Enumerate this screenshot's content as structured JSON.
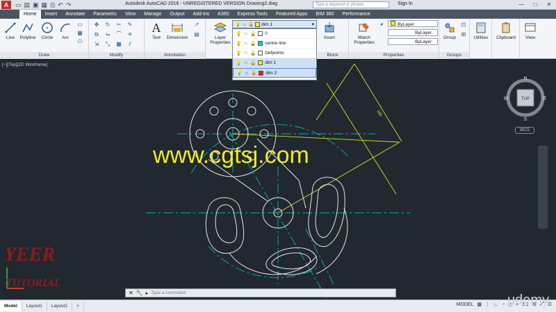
{
  "app": {
    "title": "Autodesk AutoCAD 2016 - UNREGISTERED VERSION   Drawing2.dwg",
    "search_placeholder": "Type a keyword or phrase",
    "signin": "Sign In"
  },
  "tabs": [
    "Home",
    "Insert",
    "Annotate",
    "Parametric",
    "View",
    "Manage",
    "Output",
    "Add-ins",
    "A360",
    "Express Tools",
    "Featured Apps",
    "BIM 360",
    "Performance"
  ],
  "ribbon": {
    "draw": {
      "label": "Draw",
      "line": "Line",
      "polyline": "Polyline",
      "circle": "Circle",
      "arc": "Arc"
    },
    "modify": {
      "label": "Modify"
    },
    "annotation": {
      "label": "Annotation",
      "text": "Text",
      "dimension": "Dimension"
    },
    "layers": {
      "layer_properties": "Layer Properties"
    },
    "block": {
      "label": "Block",
      "insert": "Insert"
    },
    "properties": {
      "label": "Properties",
      "match": "Match Properties",
      "color": "ByLayer",
      "linetype": "ByLayer",
      "lineweight": "ByLayer"
    },
    "groups": {
      "label": "Groups",
      "group": "Group"
    },
    "utilities": "Utilities",
    "clipboard": "Clipboard",
    "view": "View"
  },
  "layer_dropdown": {
    "current": "dim 1",
    "items": [
      {
        "name": "0",
        "color": "#ffffff"
      },
      {
        "name": "centre line",
        "color": "#00d4d4"
      },
      {
        "name": "Defpoints",
        "color": "#ffffff"
      },
      {
        "name": "dim 1",
        "color": "#f5f500"
      },
      {
        "name": "dim 2",
        "color": "#e02020"
      }
    ]
  },
  "viewport": {
    "label": "[−][Top][2D Wireframe]"
  },
  "viewcube": {
    "n": "N",
    "s": "S",
    "e": "E",
    "w": "W",
    "top": "TOP",
    "wcs": "WCS"
  },
  "command": {
    "placeholder": "Type a command"
  },
  "status": {
    "tabs": [
      "Model",
      "Layout1",
      "Layout2"
    ],
    "mode": "MODEL",
    "scale": "1:1"
  },
  "watermarks": {
    "site": "www.cgtsj.com",
    "brand1": "YEER",
    "brand2": "TUTORIAL",
    "udemy": "udemy"
  },
  "drawing": {
    "dim_text": "180"
  },
  "colors": {
    "centre_line": "#00b7b0",
    "dim_line": "#dede20",
    "geometry": "#e6e6e6",
    "background": "#212830"
  }
}
